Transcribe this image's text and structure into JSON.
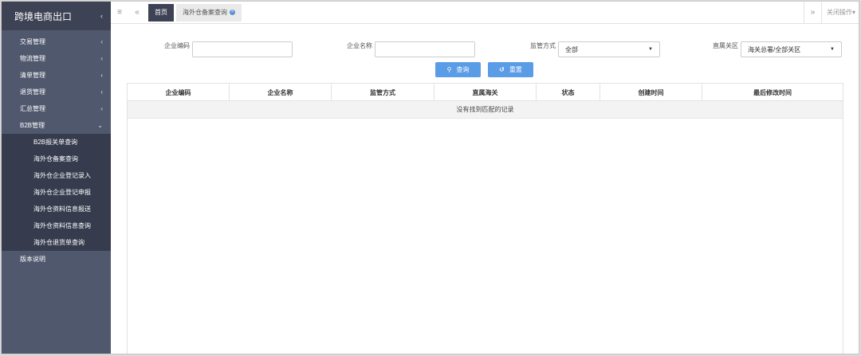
{
  "sidebar": {
    "brand": "跨境电商出口",
    "items": [
      {
        "label": "交易管理"
      },
      {
        "label": "物流管理"
      },
      {
        "label": "清单管理"
      },
      {
        "label": "退货管理"
      },
      {
        "label": "汇总管理"
      },
      {
        "label": "B2B管理"
      }
    ],
    "submenu": [
      {
        "label": "B2B报关单查询"
      },
      {
        "label": "海外仓备案查询"
      },
      {
        "label": "海外仓企业登记录入"
      },
      {
        "label": "海外仓企业登记申报"
      },
      {
        "label": "海外仓资料信息报送"
      },
      {
        "label": "海外仓资料信息查询"
      },
      {
        "label": "海外仓退货单查询"
      }
    ],
    "version": "版本说明"
  },
  "tabbar": {
    "home": "首页",
    "active_tab": "海外仓备案查询",
    "close_ops": "关闭操作"
  },
  "form": {
    "company_code_label": "企业编码",
    "company_name_label": "企业名称",
    "supervision_label": "监管方式",
    "supervision_value": "全部",
    "customs_label": "直属关区",
    "customs_value": "海关总署/全部关区",
    "search_label": "查询",
    "reset_label": "重置"
  },
  "table": {
    "columns": [
      "企业编码",
      "企业名称",
      "监管方式",
      "直属海关",
      "状态",
      "创建时间",
      "最后修改时间"
    ],
    "empty_text": "没有找到匹配的记录"
  },
  "colors": {
    "sidebar_bg": "#50586e",
    "sidebar_dark": "#3d4354",
    "submenu_bg": "#363c4d",
    "accent": "#5b9ce6"
  }
}
